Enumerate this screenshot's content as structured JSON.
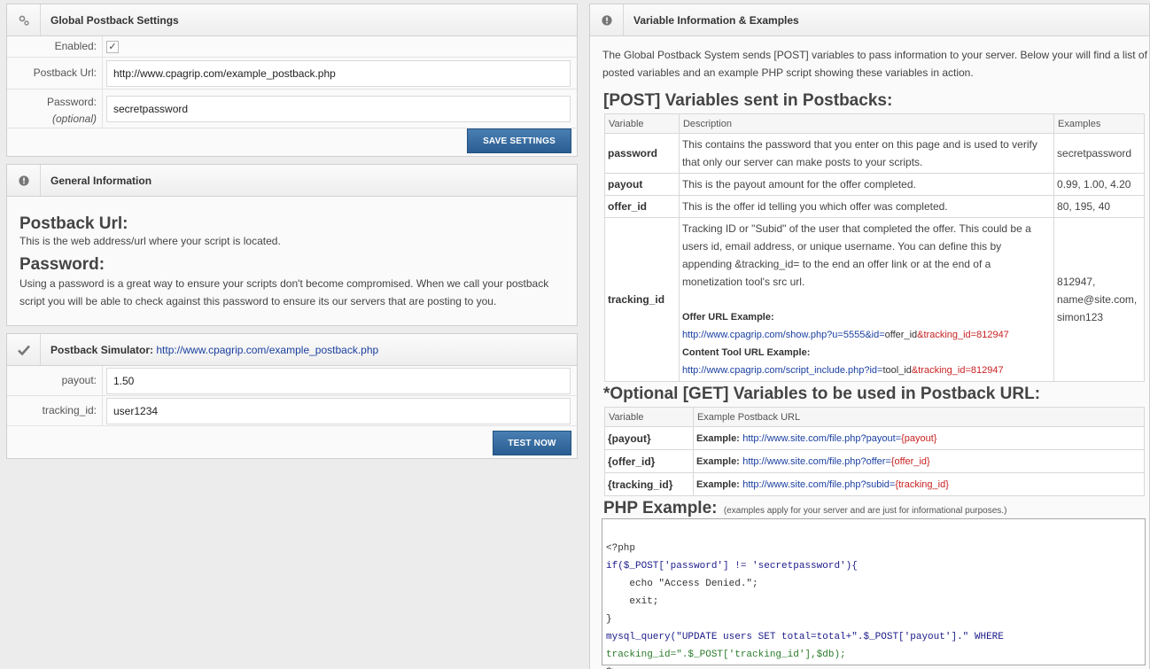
{
  "global_settings": {
    "title": "Global Postback Settings",
    "enabled_label": "Enabled:",
    "enabled_check": "✓",
    "url_label": "Postback Url:",
    "url_value": "http://www.cpagrip.com/example_postback.php",
    "password_label": "Password:",
    "password_optional": "(optional)",
    "password_value": "secretpassword",
    "save_button": "SAVE SETTINGS"
  },
  "general_info": {
    "title": "General Information",
    "url_heading": "Postback Url:",
    "url_text": "This is the web address/url where your script is located.",
    "password_heading": "Password:",
    "password_text": "Using a password is a great way to ensure your scripts don't become compromised. When we call your postback script you will be able to check against this password to ensure its our servers that are posting to you."
  },
  "simulator": {
    "title": "Postback Simulator:",
    "title_link": "http://www.cpagrip.com/example_postback.php",
    "payout_label": "payout:",
    "payout_value": "1.50",
    "tracking_label": "tracking_id:",
    "tracking_value": "user1234",
    "test_button": "TEST NOW"
  },
  "variable_info": {
    "title": "Variable Information & Examples",
    "intro": "The Global Postback System sends [POST] variables to pass information to your server. Below your will find a list of posted variables and an example PHP script showing these variables in action.",
    "post_heading": "[POST] Variables sent in Postbacks:",
    "post_columns": [
      "Variable",
      "Description",
      "Examples"
    ],
    "post_rows": [
      {
        "name": "password",
        "desc": "This contains the password that you enter on this page and is used to verify that only our server can make posts to your scripts.",
        "example": "secretpassword"
      },
      {
        "name": "payout",
        "desc": "This is the payout amount for the offer completed.",
        "example": "0.99, 1.00, 4.20"
      },
      {
        "name": "offer_id",
        "desc": "This is the offer id telling you which offer was completed.",
        "example": "80, 195, 40"
      }
    ],
    "tracking_row": {
      "name": "tracking_id",
      "desc": "Tracking ID or \"Subid\" of the user that completed the offer. This could be a users id, email address, or unique username. You can define this by appending &tracking_id= to the end an offer link or at the end of a monetization tool's src url.",
      "offer_label": "Offer URL Example:",
      "offer_url_a": "http://www.cpagrip.com/show.php?u=5555&id=",
      "offer_url_b": "offer_id",
      "offer_url_c": "&tracking_id=812947",
      "tool_label": "Content Tool URL Example:",
      "tool_url_a": "http://www.cpagrip.com/script_include.php?id=",
      "tool_url_b": "tool_id",
      "tool_url_c": "&tracking_id=812947",
      "ex1": "812947,",
      "ex2": "name@site.com,",
      "ex3": "simon123"
    },
    "get_heading": "*Optional [GET] Variables to be used in Postback URL:",
    "get_columns": [
      "Variable",
      "Example Postback URL"
    ],
    "get_rows": [
      {
        "name": "{payout}",
        "prefix": "Example:",
        "url": "http://www.site.com/file.php?payout=",
        "token": "{payout}"
      },
      {
        "name": "{offer_id}",
        "prefix": "Example:",
        "url": "http://www.site.com/file.php?offer=",
        "token": "{offer_id}"
      },
      {
        "name": "{tracking_id}",
        "prefix": "Example:",
        "url": "http://www.site.com/file.php?subid=",
        "token": "{tracking_id}"
      }
    ],
    "php_heading": "PHP Example:",
    "php_note": "(examples apply for your server and are just for informational purposes.)",
    "php_lines": [
      "<?php",
      "if($_POST['password'] != 'secretpassword'){",
      "    echo \"Access Denied.\";",
      "    exit;",
      "}",
      "mysql_query(\"UPDATE users SET total=total+\".$_POST['payout'].\" WHERE",
      "tracking_id=\".$_POST['tracking_id'],$db);",
      "?>"
    ]
  },
  "colors": {
    "button": "#2a5d91",
    "link": "#1a3fa0",
    "token": "#c82222"
  },
  "icons": {
    "settings": "gears-icon",
    "info": "exclamation-icon",
    "simulator": "checkmark-icon"
  }
}
